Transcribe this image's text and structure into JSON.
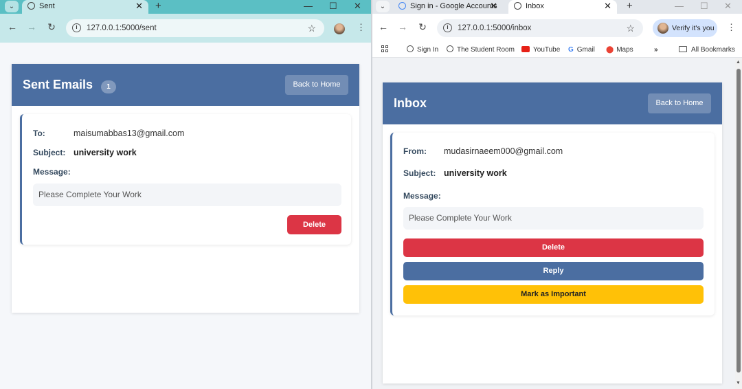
{
  "left_browser": {
    "tab_title": "Sent",
    "url": "127.0.0.1:5000/sent",
    "page": {
      "title": "Sent Emails",
      "count": "1",
      "back_button": "Back to Home",
      "email": {
        "to_label": "To:",
        "to_value": "maisumabbas13@gmail.com",
        "subject_label": "Subject:",
        "subject_value": "university work",
        "message_label": "Message:",
        "message_value": "Please Complete Your Work",
        "delete_button": "Delete"
      }
    }
  },
  "right_browser": {
    "tabs": [
      "Sign in - Google Accounts",
      "Inbox"
    ],
    "url": "127.0.0.1:5000/inbox",
    "verify_button": "Verify it's you",
    "bookmarks": [
      "Sign In",
      "The Student Room",
      "YouTube",
      "Gmail",
      "Maps"
    ],
    "all_bookmarks": "All Bookmarks",
    "page": {
      "title": "Inbox",
      "back_button": "Back to Home",
      "email": {
        "from_label": "From:",
        "from_value": "mudasirnaeem000@gmail.com",
        "subject_label": "Subject:",
        "subject_value": "university work",
        "message_label": "Message:",
        "message_value": "Please Complete Your Work",
        "delete_button": "Delete",
        "reply_button": "Reply",
        "important_button": "Mark as Important"
      }
    }
  },
  "colors": {
    "header_blue": "#4b6ea1",
    "delete_red": "#dc3545",
    "important_yellow": "#ffc107",
    "left_theme_teal": "#5bbfc4"
  }
}
